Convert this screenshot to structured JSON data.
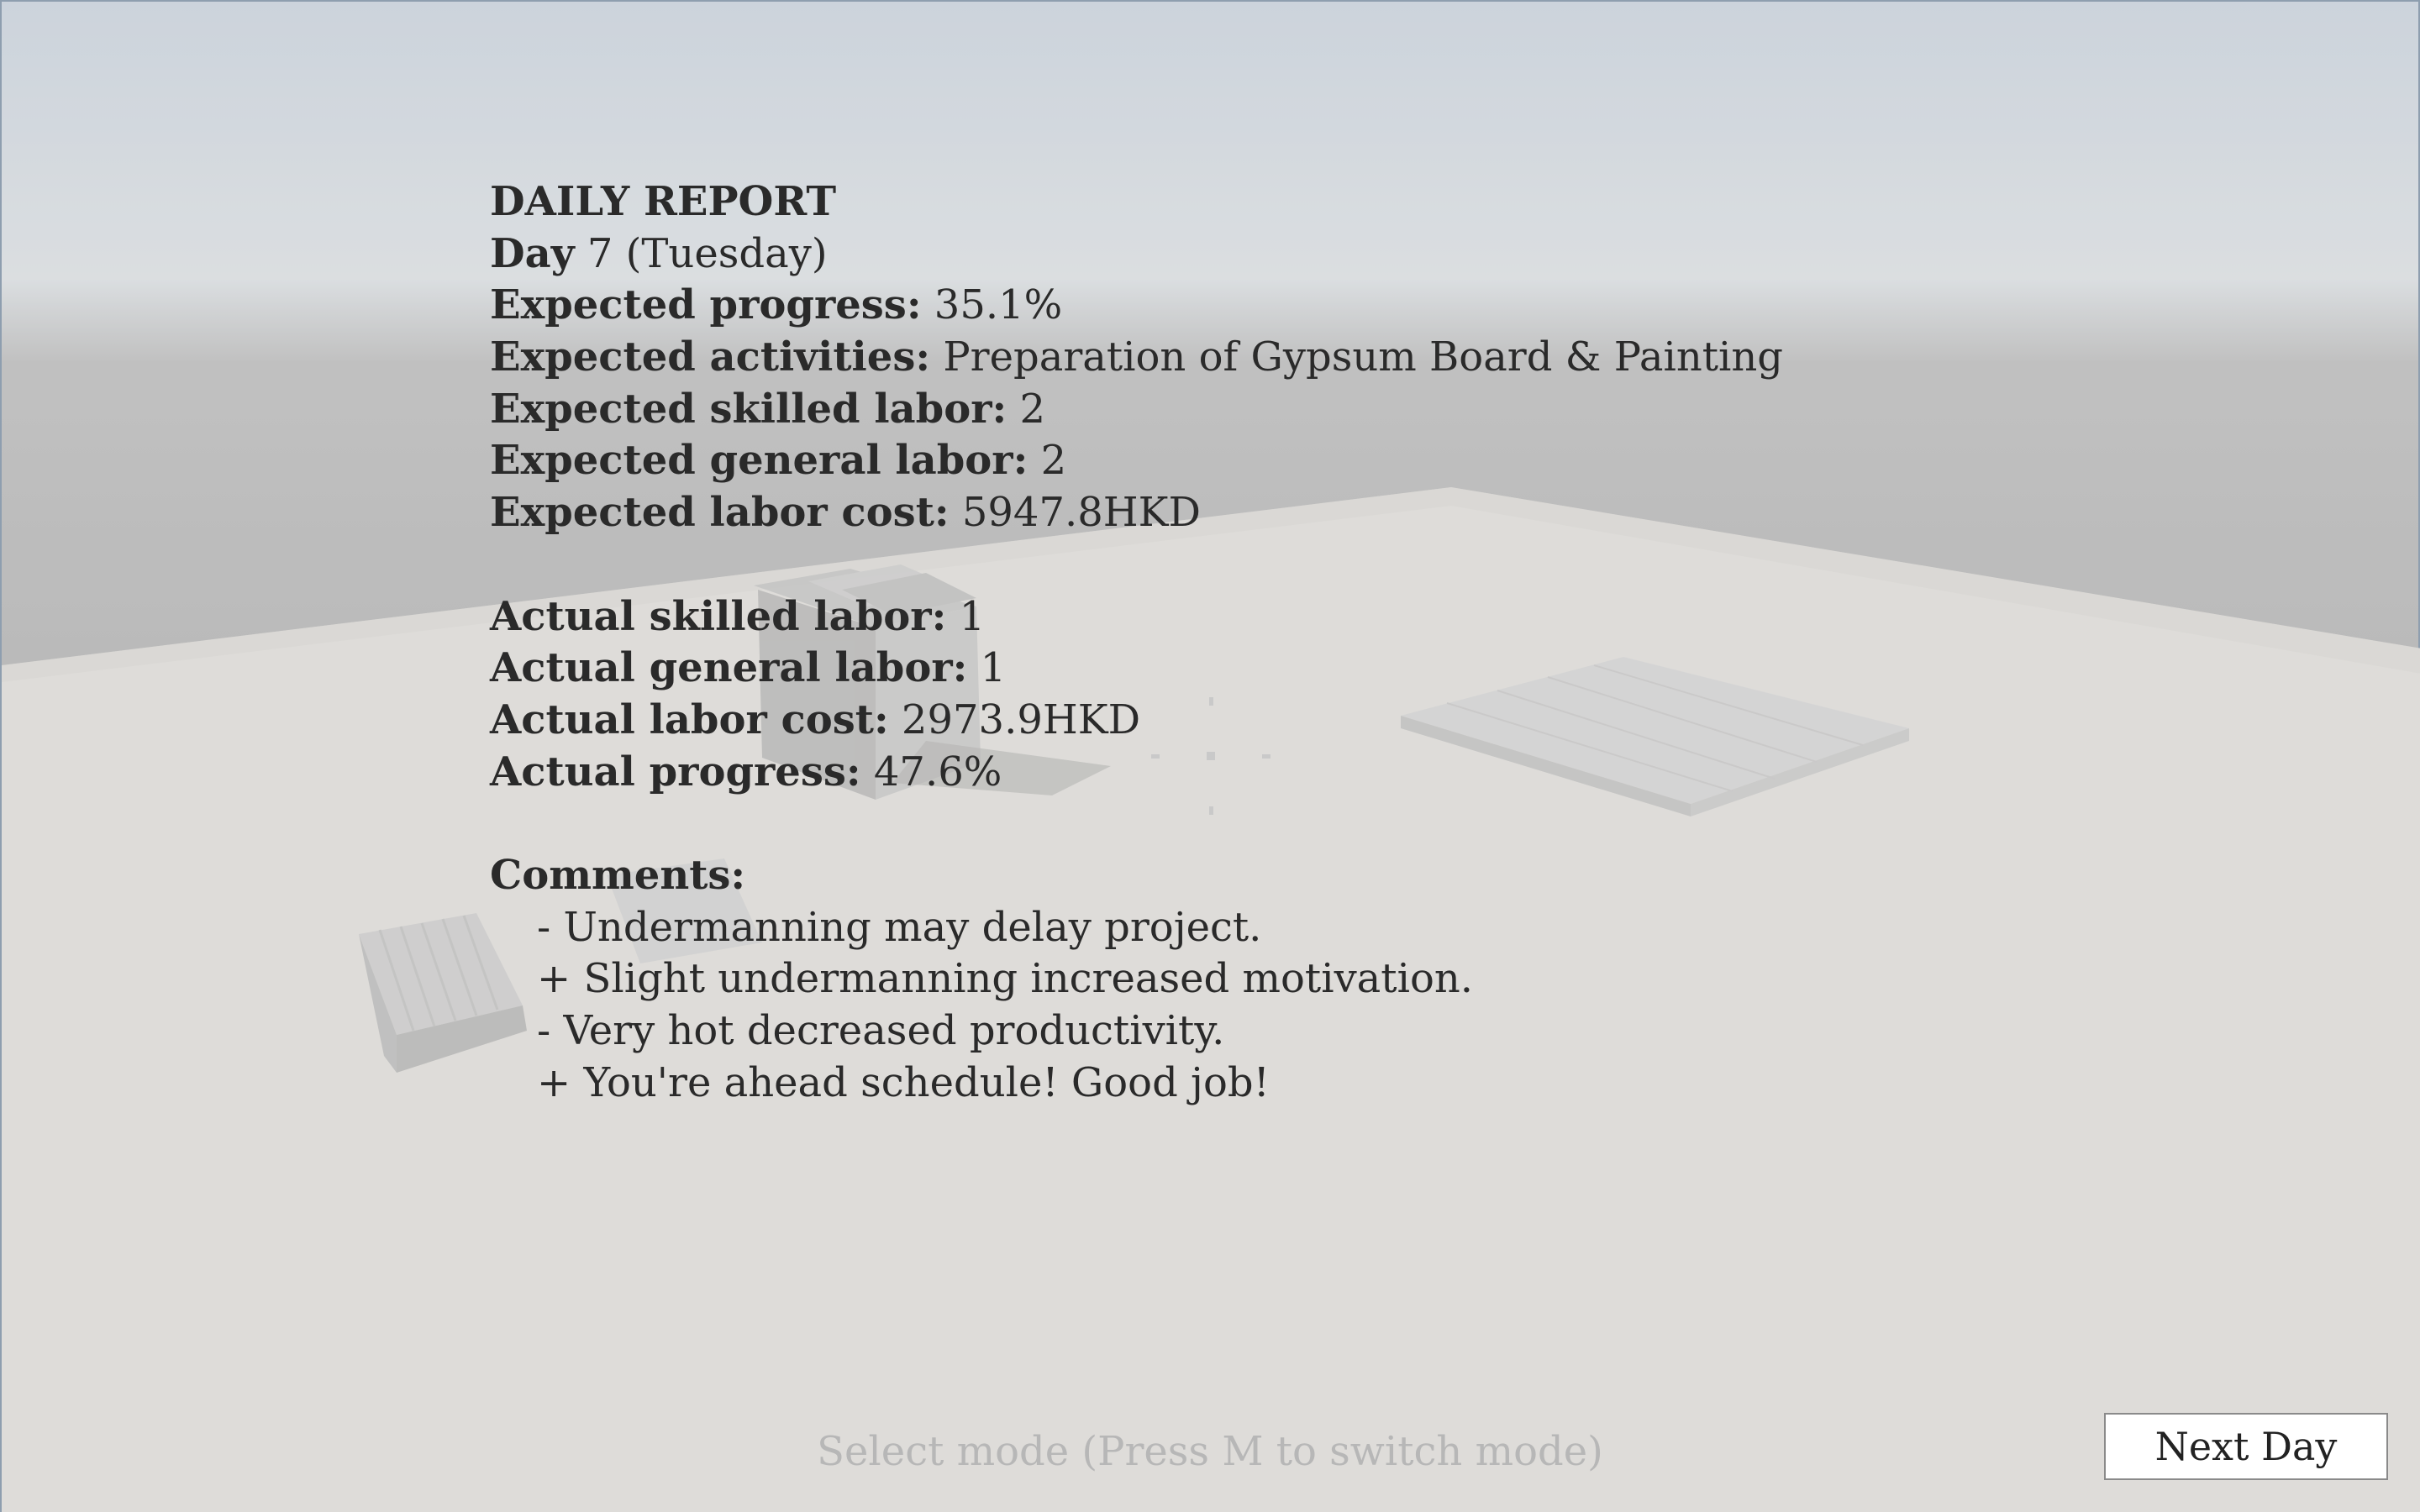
{
  "report": {
    "title": "DAILY REPORT",
    "day_label": "Day",
    "day_value": " 7 (Tuesday)",
    "expected": [
      {
        "label": "Expected progress:",
        "value": " 35.1%"
      },
      {
        "label": "Expected activities:",
        "value": " Preparation of Gypsum Board & Painting"
      },
      {
        "label": "Expected skilled labor:",
        "value": " 2"
      },
      {
        "label": "Expected general labor:",
        "value": " 2"
      },
      {
        "label": "Expected labor cost:",
        "value": " 5947.8HKD"
      }
    ],
    "actual": [
      {
        "label": "Actual skilled labor:",
        "value": " 1"
      },
      {
        "label": "Actual general labor:",
        "value": " 1"
      },
      {
        "label": "Actual labor cost:",
        "value": " 2973.9HKD"
      },
      {
        "label": "Actual progress:",
        "value": " 47.6%"
      }
    ],
    "comments_label": "Comments:",
    "comments": [
      "- Undermanning may delay project.",
      "+ Slight undermanning increased motivation.",
      "- Very hot decreased productivity.",
      "+ You're ahead schedule! Good job!"
    ]
  },
  "mode_hint": "Select mode (Press M to switch mode)",
  "next_day_button": "Next Day",
  "colors": {
    "sky": "#c6cfda",
    "ground": "#d8d6d2",
    "text": "#2a2a2a",
    "hint": "#b7b7b7"
  }
}
